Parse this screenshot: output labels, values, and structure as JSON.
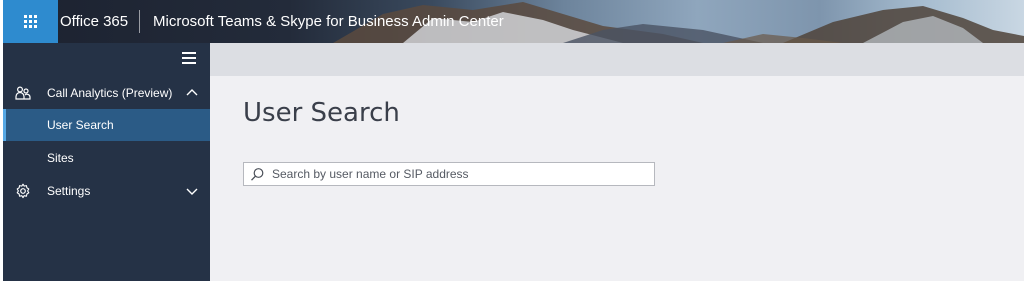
{
  "header": {
    "brand": "Office 365",
    "app_title": "Microsoft Teams & Skype for Business Admin Center",
    "waffle_icon": "app-launcher-icon",
    "colors": {
      "waffle_bg": "#2e8bcf"
    }
  },
  "sidebar": {
    "menu_icon": "hamburger-icon",
    "items": [
      {
        "label": "Call Analytics (Preview)",
        "icon": "people-icon",
        "expanded": true
      },
      {
        "label": "User Search",
        "active": true
      },
      {
        "label": "Sites"
      },
      {
        "label": "Settings",
        "icon": "gear-icon",
        "expanded": false
      }
    ],
    "colors": {
      "background": "#253246",
      "active": "#2b5b86",
      "active_marker": "#55a8e5"
    }
  },
  "main": {
    "title": "User Search",
    "search": {
      "placeholder": "Search by user name or SIP address",
      "value": ""
    }
  }
}
